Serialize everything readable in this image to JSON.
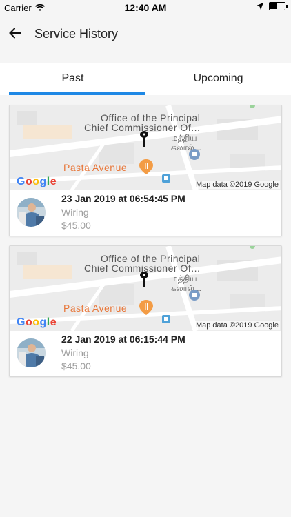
{
  "status_bar": {
    "carrier": "Carrier",
    "time": "12:40 AM",
    "battery_level": 0.5
  },
  "nav": {
    "title": "Service History"
  },
  "tabs": [
    {
      "label": "Past",
      "active": true
    },
    {
      "label": "Upcoming",
      "active": false
    }
  ],
  "map": {
    "label_line1": "Office of the Principal",
    "label_line2": "Chief Commissioner Of...",
    "tamil_line1": "மத்திய",
    "tamil_line2": "கலால்...",
    "place": "Pasta Avenue",
    "google": "Google",
    "map_data": "Map data ©2019 Google"
  },
  "history": [
    {
      "date": "23 Jan 2019 at 06:54:45 PM",
      "service": "Wiring",
      "price": "$45.00"
    },
    {
      "date": "22 Jan 2019 at 06:15:44 PM",
      "service": "Wiring",
      "price": "$45.00"
    }
  ],
  "colors": {
    "accent": "#1e88e5",
    "place": "#e8773a",
    "pin": "#111111"
  }
}
